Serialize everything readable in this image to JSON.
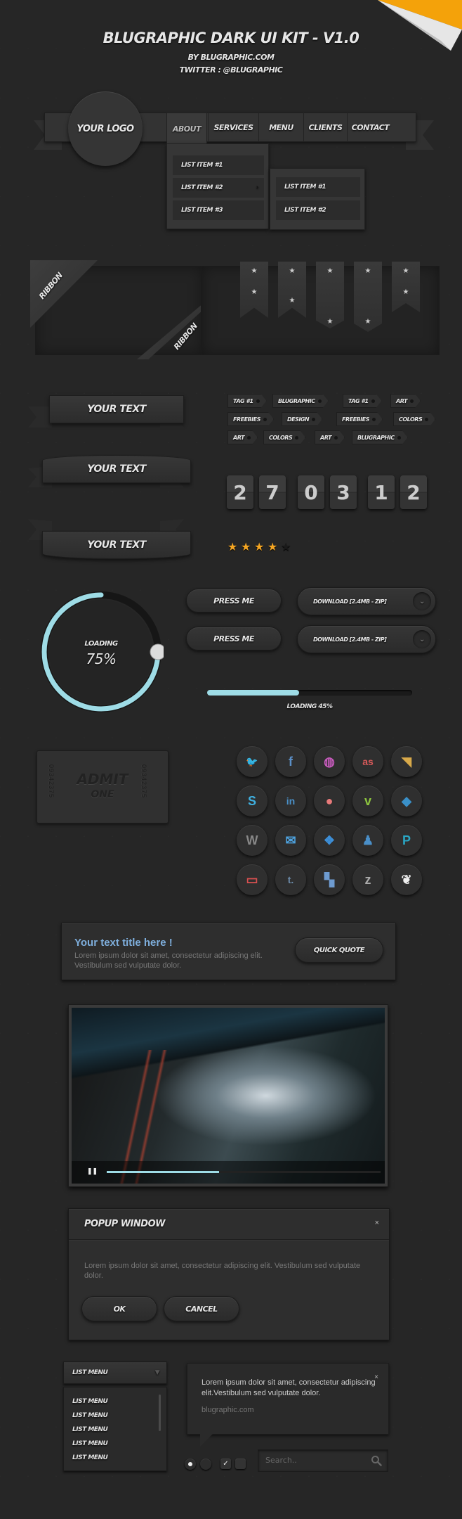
{
  "header": {
    "title": "Blugraphic Dark UI Kit - V1.0",
    "byline": "By Blugraphic.com",
    "twitter": "Twitter : @Blugraphic"
  },
  "nav": {
    "logo": "Your Logo",
    "items": [
      "About",
      "Services",
      "Menu",
      "Clients",
      "Contact"
    ],
    "active": "About",
    "dropdown": [
      "List Item #1",
      "List Item #2",
      "List Item #3"
    ],
    "submenu": [
      "List Item #1",
      "List Item #2"
    ]
  },
  "ribbons": {
    "corner_label": "Ribbon",
    "bookmarks": [
      {
        "stars": 2,
        "tail": "notch"
      },
      {
        "stars": 2,
        "tail": "notch"
      },
      {
        "stars": 2,
        "tail": "point"
      },
      {
        "stars": 2,
        "tail": "point"
      },
      {
        "stars": 2,
        "tail": "notch"
      }
    ]
  },
  "banners": [
    "Your Text",
    "Your Text",
    "Your Text"
  ],
  "tags": [
    [
      "Tag #1",
      "Blugraphic",
      "Tag #1",
      "Art"
    ],
    [
      "Freebies",
      "Design",
      "Freebies",
      "Colors"
    ],
    [
      "Art",
      "Colors",
      "Art",
      "Blugraphic"
    ]
  ],
  "flip_counter": {
    "digits": [
      "2",
      "7",
      "0",
      "3",
      "1",
      "2"
    ]
  },
  "rating": {
    "value": 4,
    "max": 5,
    "filled_color": "#f5a623"
  },
  "circular_loader": {
    "label": "Loading",
    "percent": 75,
    "display": "75%",
    "accent": "#9edce6"
  },
  "buttons": {
    "press_me": [
      "Press Me",
      "Press Me"
    ],
    "download": [
      "Download [2.4MB - ZIP]",
      "Download [2.4MB - ZIP]"
    ]
  },
  "linear_loader": {
    "label": "Loading 45%",
    "percent": 45
  },
  "ticket": {
    "line1": "Admit",
    "line2": "One",
    "serial": "09342375"
  },
  "social": [
    {
      "name": "twitter",
      "glyph": "🐦",
      "color": "#7cc6df"
    },
    {
      "name": "facebook",
      "glyph": "f",
      "color": "#5b8fc7"
    },
    {
      "name": "dribbble",
      "glyph": "◍",
      "color": "#c75bbd"
    },
    {
      "name": "lastfm",
      "glyph": "as",
      "color": "#d85a5a"
    },
    {
      "name": "rss",
      "glyph": "◥",
      "color": "#d8a94a"
    },
    {
      "name": "skype",
      "glyph": "S",
      "color": "#3fb0e0"
    },
    {
      "name": "linkedin",
      "glyph": "in",
      "color": "#4a90c8"
    },
    {
      "name": "github",
      "glyph": "●",
      "color": "#e87a7a"
    },
    {
      "name": "vimeo",
      "glyph": "v",
      "color": "#8ec63f"
    },
    {
      "name": "digg",
      "glyph": "◆",
      "color": "#3a90c8"
    },
    {
      "name": "wordpress",
      "glyph": "W",
      "color": "#888888"
    },
    {
      "name": "email",
      "glyph": "✉",
      "color": "#4ea3e0"
    },
    {
      "name": "dropbox",
      "glyph": "❖",
      "color": "#3d8fd8"
    },
    {
      "name": "myspace",
      "glyph": "♟",
      "color": "#4a8fc8"
    },
    {
      "name": "posterous",
      "glyph": "P",
      "color": "#2aa6c4"
    },
    {
      "name": "tv",
      "glyph": "▭",
      "color": "#d85050"
    },
    {
      "name": "tumblr",
      "glyph": "t.",
      "color": "#6b8aa8"
    },
    {
      "name": "delicious",
      "glyph": "▚",
      "color": "#6e9bd0"
    },
    {
      "name": "zerply",
      "glyph": "z",
      "color": "#aaaaaa"
    },
    {
      "name": "envato",
      "glyph": "❦",
      "color": "#eeeeee"
    }
  ],
  "callout": {
    "title": "Your text title here !",
    "text": "Lorem ipsum dolor sit amet, consectetur adipiscing elit. Vestibulum sed vulputate dolor.",
    "button": "Quick Quote"
  },
  "video": {
    "progress_percent": 41,
    "state": "playing"
  },
  "popup": {
    "title": "Popup Window",
    "text": "Lorem ipsum dolor sit amet, consectetur adipiscing elit. Vestibulum sed vulputate dolor.",
    "ok": "OK",
    "cancel": "Cancel",
    "close": "×"
  },
  "list_menu": {
    "selected": "List Menu",
    "items": [
      "List Menu",
      "List Menu",
      "List Menu",
      "List Menu",
      "List Menu"
    ]
  },
  "tooltip": {
    "text": "Lorem ipsum dolor sit amet, consectetur adipiscing elit.Vestibulum sed vulputate dolor.",
    "link": "blugraphic.com",
    "close": "×"
  },
  "form": {
    "radios": [
      true,
      false
    ],
    "checkboxes": [
      true,
      false
    ],
    "search_placeholder": "Search.."
  }
}
